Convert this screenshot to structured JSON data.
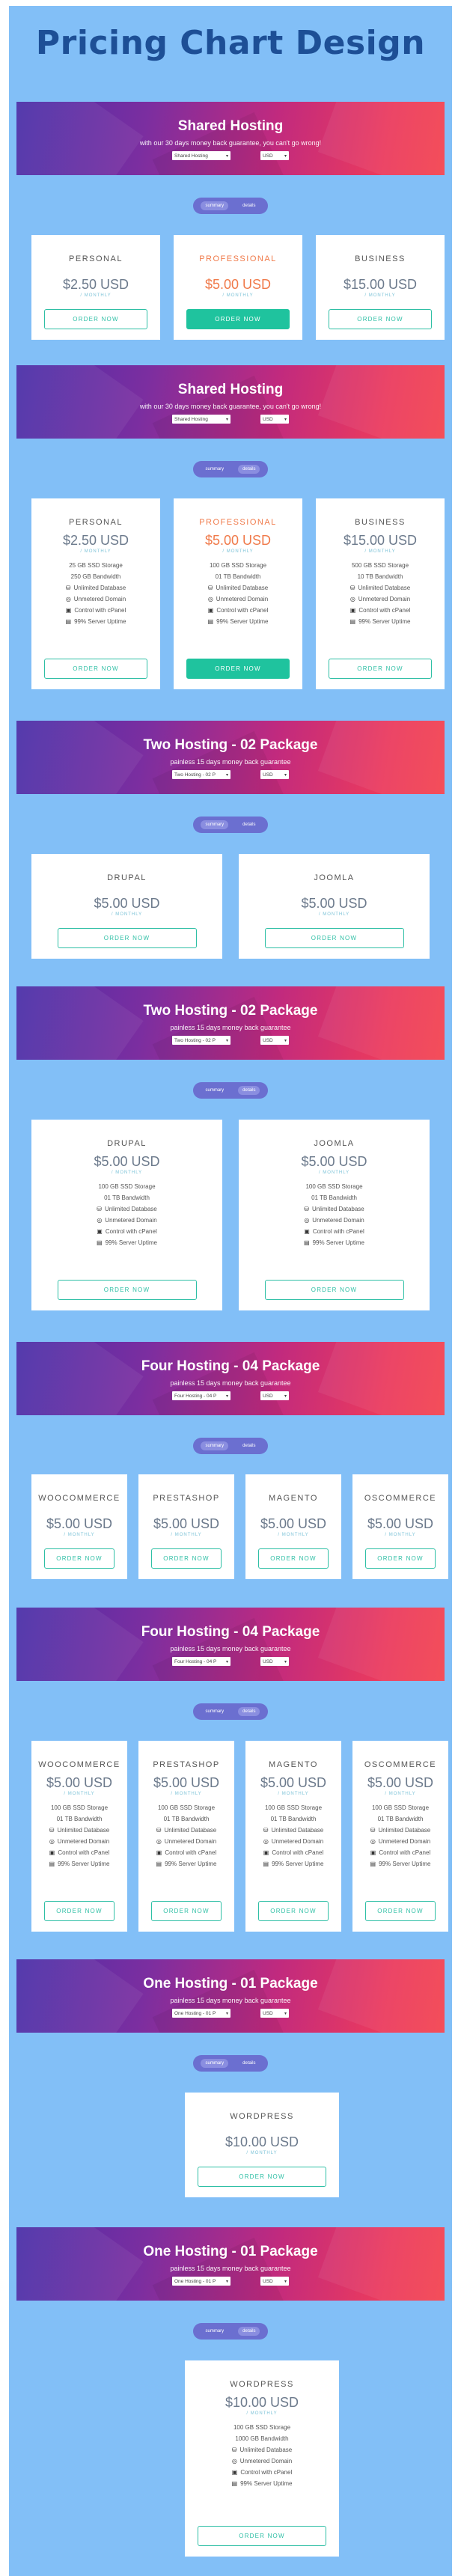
{
  "page_title": "Pricing Chart Design",
  "sections": {
    "s1": {
      "title": "Shared Hosting",
      "subtitle": "with our 30 days money back guarantee, you can't go wrong!",
      "select1": "Shared Hosting",
      "select2": "USD"
    },
    "s2": {
      "title": "Shared Hosting",
      "subtitle": "with our 30 days money back guarantee, you can't go wrong!",
      "select1": "Shared Hosting",
      "select2": "USD"
    },
    "s3": {
      "title": "Two Hosting - 02 Package",
      "subtitle": "painless 15 days money back guarantee",
      "select1": "Two Hosting - 02 P",
      "select2": "USD"
    },
    "s4": {
      "title": "Two Hosting - 02 Package",
      "subtitle": "painless 15 days money back guarantee",
      "select1": "Two Hosting - 02 P",
      "select2": "USD"
    },
    "s5": {
      "title": "Four Hosting - 04 Package",
      "subtitle": "painless 15 days money back guarantee",
      "select1": "Four Hosting - 04 P",
      "select2": "USD"
    },
    "s6": {
      "title": "Four Hosting - 04 Package",
      "subtitle": "painless 15 days money back guarantee",
      "select1": "Four Hosting - 04 P",
      "select2": "USD"
    },
    "s7": {
      "title": "One Hosting - 01 Package",
      "subtitle": "painless 15 days money back guarantee",
      "select1": "One Hosting - 01 P",
      "select2": "USD"
    },
    "s8": {
      "title": "One Hosting - 01 Package",
      "subtitle": "painless 15 days money back guarantee",
      "select1": "One Hosting - 01 P",
      "select2": "USD"
    }
  },
  "toggle": {
    "summary": "summary",
    "details": "details"
  },
  "per": "/ MONTHLY",
  "order_label": "ORDER NOW",
  "plans": {
    "personal": {
      "name": "PERSONAL",
      "price": "$2.50 USD"
    },
    "professional": {
      "name": "PROFESSIONAL",
      "price": "$5.00 USD"
    },
    "business": {
      "name": "BUSINESS",
      "price": "$15.00 USD"
    },
    "drupal": {
      "name": "DRUPAL",
      "price": "$5.00 USD"
    },
    "joomla": {
      "name": "JOOMLA",
      "price": "$5.00 USD"
    },
    "woocommerce": {
      "name": "WOOCOMMERCE",
      "price": "$5.00 USD"
    },
    "prestashop": {
      "name": "PRESTASHOP",
      "price": "$5.00 USD"
    },
    "magento": {
      "name": "MAGENTO",
      "price": "$5.00 USD"
    },
    "oscommerce": {
      "name": "OSCOMMERCE",
      "price": "$5.00 USD"
    },
    "wordpress": {
      "name": "WORDPRESS",
      "price": "$10.00 USD"
    }
  },
  "features": {
    "personal": [
      "25 GB SSD Storage",
      "250 GB Bandwidth",
      "Unlimited Database",
      "Unmetered Domain",
      "Control with cPanel",
      "99% Server Uptime"
    ],
    "professional": [
      "100 GB SSD Storage",
      "01 TB Bandwidth",
      "Unlimited Database",
      "Unmetered Domain",
      "Control with cPanel",
      "99% Server Uptime"
    ],
    "business": [
      "500 GB SSD Storage",
      "10 TB Bandwidth",
      "Unlimited Database",
      "Unmetered Domain",
      "Control with cPanel",
      "99% Server Uptime"
    ],
    "standard": [
      "100 GB SSD Storage",
      "01 TB Bandwidth",
      "Unlimited Database",
      "Unmetered Domain",
      "Control with cPanel",
      "99% Server Uptime"
    ],
    "wordpress": [
      "100 GB SSD Storage",
      "1000 GB Bandwidth",
      "Unlimited Database",
      "Unmetered Domain",
      "Control with cPanel",
      "99% Server Uptime"
    ]
  },
  "feature_icons": [
    "",
    "",
    "database-icon",
    "globe-icon",
    "cpanel-icon",
    "server-icon"
  ]
}
